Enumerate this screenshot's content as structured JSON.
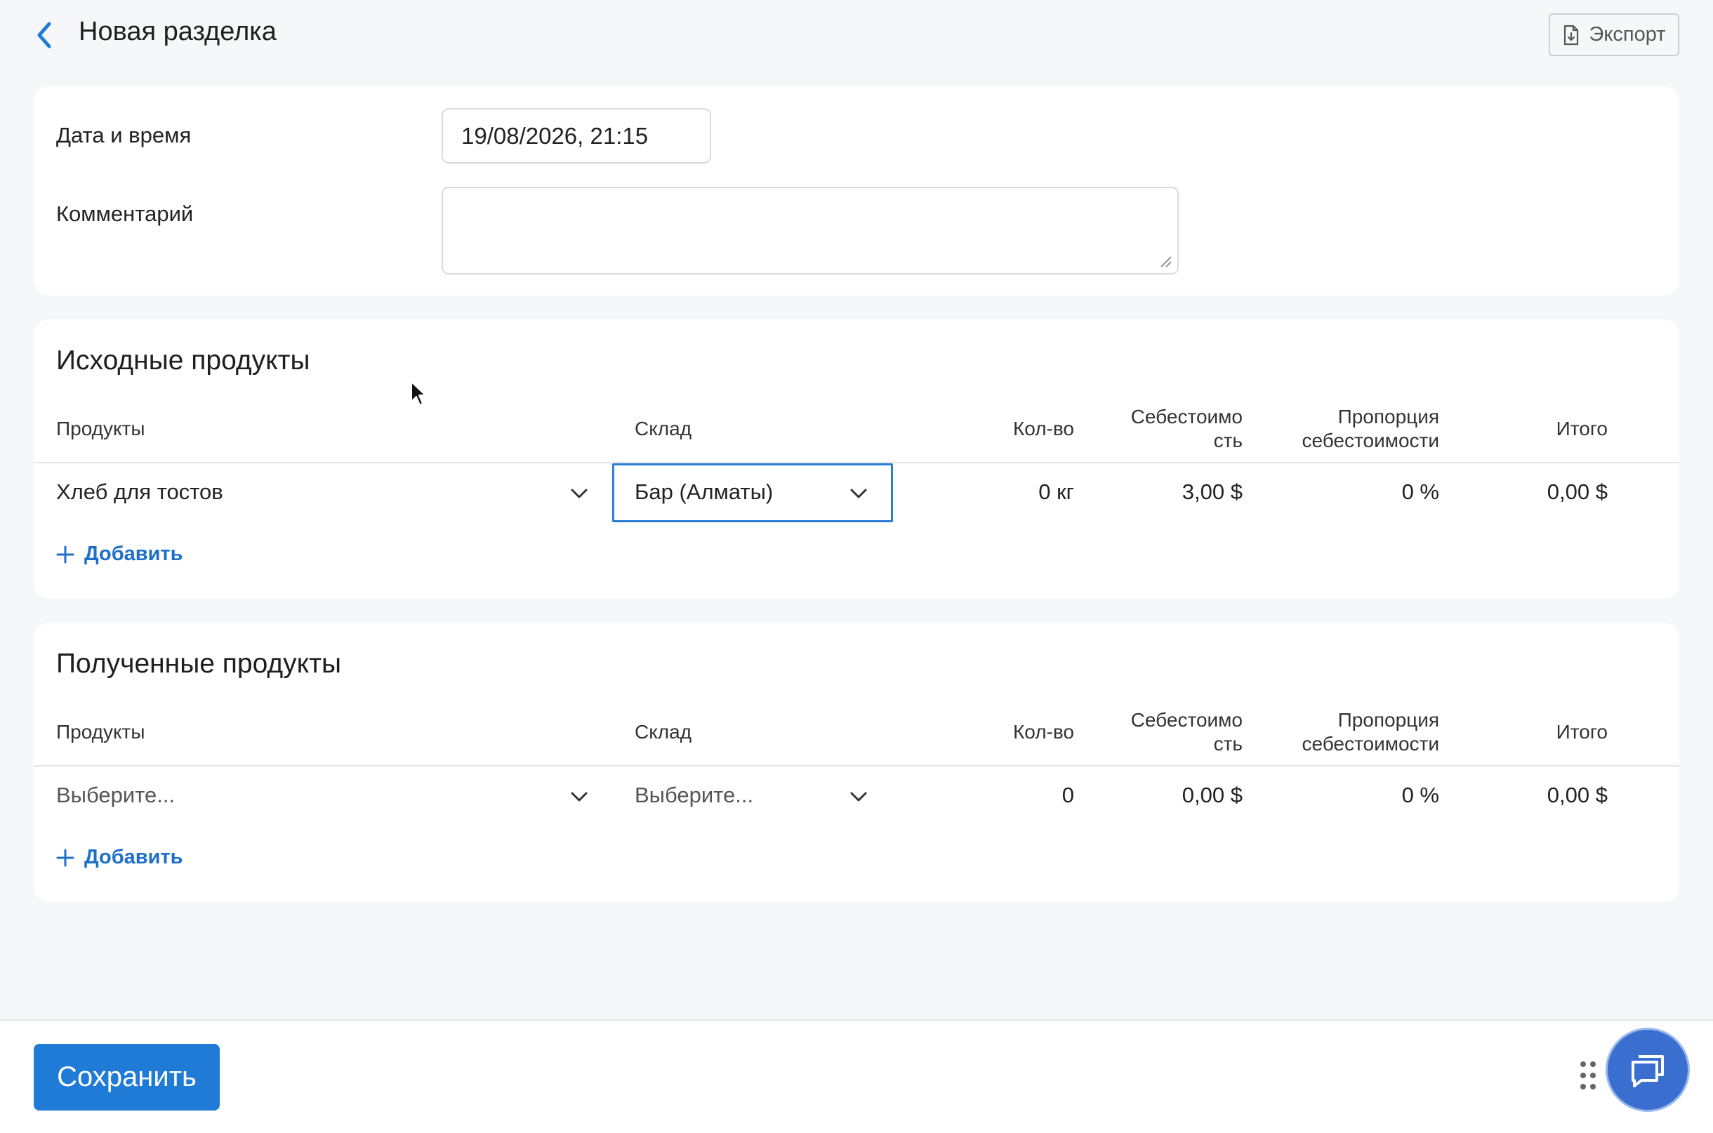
{
  "header": {
    "title": "Новая разделка",
    "export_label": "Экспорт"
  },
  "form": {
    "date_label": "Дата и время",
    "date_value": "19/08/2026, 21:15",
    "comment_label": "Комментарий",
    "comment_value": ""
  },
  "columns": {
    "products": "Продукты",
    "warehouse": "Склад",
    "qty": "Кол-во",
    "cost_line1": "Себестоимо",
    "cost_line2": "сть",
    "proportion_line1": "Пропорция",
    "proportion_line2": "себестоимости",
    "total": "Итого"
  },
  "source": {
    "title": "Исходные продукты",
    "rows": [
      {
        "product": "Хлеб для тостов",
        "warehouse": "Бар (Алматы)",
        "qty": "0 кг",
        "cost": "3,00 $",
        "proportion": "0 %",
        "total": "0,00 $"
      }
    ],
    "add_label": "Добавить"
  },
  "result": {
    "title": "Полученные продукты",
    "rows": [
      {
        "product": "Выберите...",
        "warehouse": "Выберите...",
        "qty": "0",
        "cost": "0,00 $",
        "proportion": "0 %",
        "total": "0,00 $"
      }
    ],
    "add_label": "Добавить"
  },
  "footer": {
    "save_label": "Сохранить"
  },
  "colors": {
    "accent": "#1f7bd6",
    "link": "#1e6fc8",
    "chat": "#3a6fd0",
    "background": "#f6f7f9"
  }
}
